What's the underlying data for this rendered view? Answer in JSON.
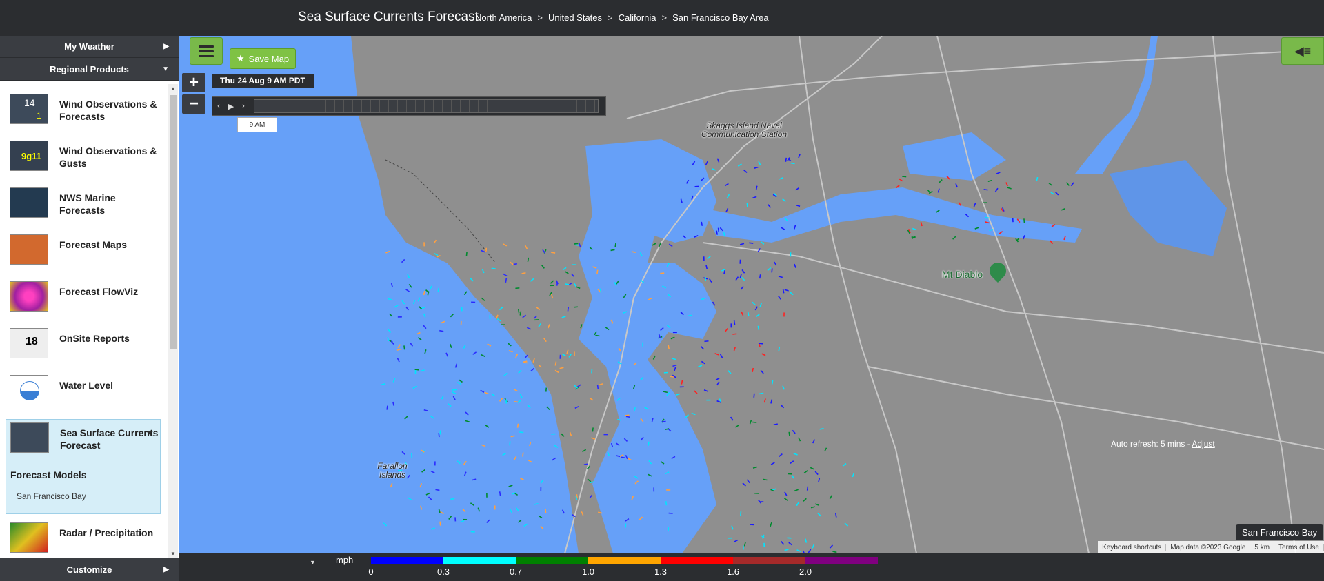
{
  "header": {
    "title": "Sea Surface Currents Forecast",
    "breadcrumbs": [
      "North America",
      "United States",
      "California",
      "San Francisco Bay Area"
    ]
  },
  "sidebar": {
    "my_weather": "My Weather",
    "regional_products": "Regional Products",
    "customize": "Customize",
    "items": [
      {
        "label": "Wind Observations & Forecasts",
        "icon": "wind-observations-icon"
      },
      {
        "label": "Wind Observations & Gusts",
        "icon": "wind-gusts-icon"
      },
      {
        "label": "NWS Marine Forecasts",
        "icon": "nws-marine-icon"
      },
      {
        "label": "Forecast Maps",
        "icon": "forecast-maps-icon"
      },
      {
        "label": "Forecast FlowViz",
        "icon": "flowviz-icon"
      },
      {
        "label": "OnSite Reports",
        "icon": "onsite-reports-icon"
      },
      {
        "label": "Water Level",
        "icon": "water-level-icon"
      },
      {
        "label": "Sea Surface Currents Forecast",
        "icon": "sea-currents-icon"
      },
      {
        "label": "Radar / Precipitation",
        "icon": "radar-icon"
      }
    ],
    "thumb_text": {
      "wind": "14",
      "wind_small": "1",
      "gusts": "9g11",
      "onsite": "18"
    },
    "active": {
      "section_title": "Forecast Models",
      "link": "San Francisco Bay"
    }
  },
  "map": {
    "save_label": "Save Map",
    "timestamp": "Thu 24 Aug 9 AM PDT",
    "time_tip": "9 AM",
    "labels": {
      "skaggs": "Skaggs Island Naval Communication Station",
      "farallon": "Farallon Islands",
      "diablo": "Mt Diablo"
    },
    "auto_refresh": "Auto refresh: 5 mins -",
    "adjust": "Adjust",
    "region_badge": "San Francisco Bay",
    "attribution": [
      "Keyboard shortcuts",
      "Map data ©2023 Google",
      "5 km",
      "Terms of Use"
    ]
  },
  "legend": {
    "unit": "mph",
    "colors": [
      "#0000ff",
      "#00ffff",
      "#008000",
      "#ffa500",
      "#ff0000",
      "#a52a2a",
      "#800080"
    ],
    "ticks": [
      "0",
      "0.3",
      "0.7",
      "1.0",
      "1.3",
      "1.6",
      "2.0"
    ]
  }
}
